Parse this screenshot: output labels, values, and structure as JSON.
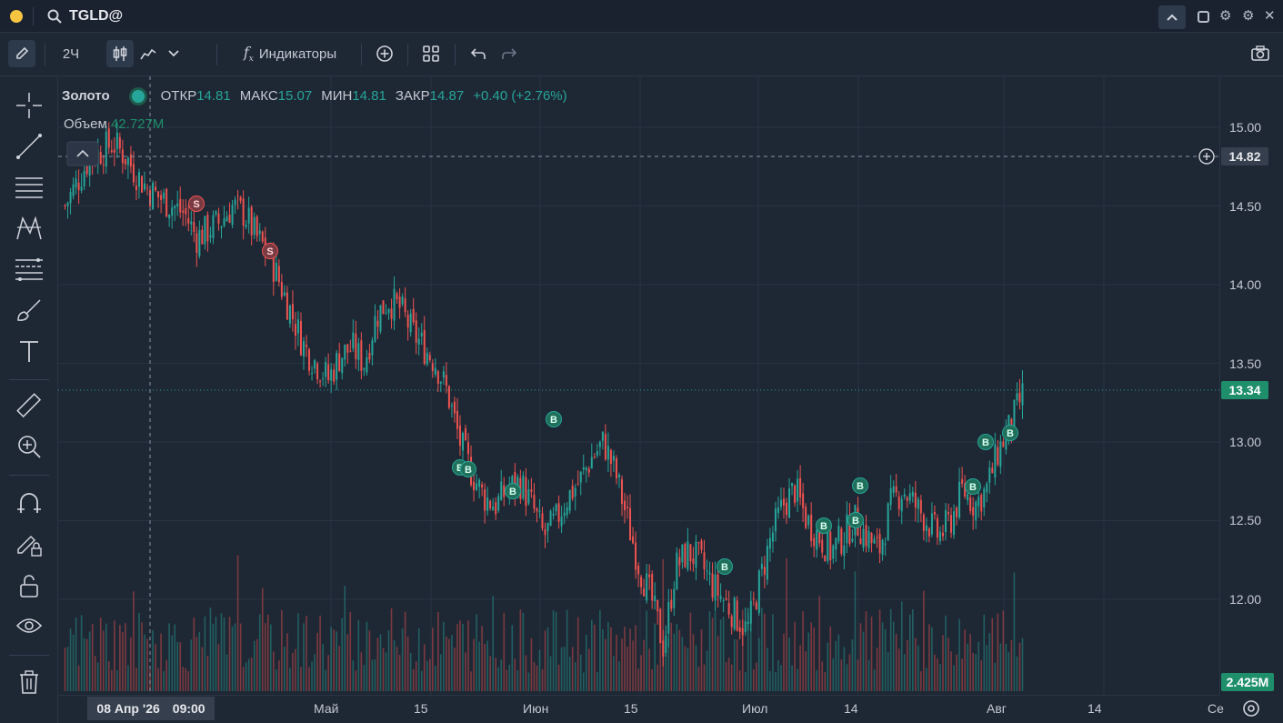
{
  "window": {
    "ticker": "TGLD@"
  },
  "toolbar": {
    "interval": "2Ч",
    "indicators_label": "Индикаторы"
  },
  "legend": {
    "name": "Золото",
    "open_label": "ОТКР",
    "open": "14.81",
    "high_label": "МАКС",
    "high": "15.07",
    "low_label": "МИН",
    "low": "14.81",
    "close_label": "ЗАКР",
    "close": "14.87",
    "change": "+0.40 (+2.76%)",
    "volume_label": "Объем",
    "volume": "42.727M"
  },
  "price_axis": {
    "ticks": [
      "15.00",
      "14.50",
      "14.00",
      "13.50",
      "13.00",
      "12.50",
      "12.00"
    ],
    "crosshair_price": "14.82",
    "last_price": "13.34",
    "volume_tag": "2.425M",
    "colors": {
      "up": "#26a69a",
      "down": "#ef5350",
      "last_price_bg": "#1f8f6b",
      "volume_tag_bg": "#1f8f6b"
    }
  },
  "time_axis": {
    "ticks": [
      "Май",
      "15",
      "Июн",
      "15",
      "Июл",
      "14",
      "Авг",
      "14",
      "Се"
    ],
    "crosshair_date": "08 Апр '26",
    "crosshair_time": "09:00"
  },
  "signals": [
    {
      "label": "S",
      "type": "sell"
    },
    {
      "label": "S",
      "type": "sell"
    },
    {
      "label": "B",
      "type": "buy"
    },
    {
      "label": "B",
      "type": "buy"
    },
    {
      "label": "B",
      "type": "buy"
    },
    {
      "label": "B",
      "type": "buy"
    },
    {
      "label": "B",
      "type": "buy"
    },
    {
      "label": "B",
      "type": "buy"
    },
    {
      "label": "B",
      "type": "buy"
    },
    {
      "label": "B",
      "type": "buy"
    },
    {
      "label": "B",
      "type": "buy"
    },
    {
      "label": "B",
      "type": "buy"
    },
    {
      "label": "B",
      "type": "buy"
    }
  ],
  "chart_data": {
    "type": "candlestick",
    "ylim": [
      11.6,
      15.2
    ],
    "close_path": [
      14.5,
      14.65,
      14.8,
      14.85,
      14.9,
      14.82,
      14.7,
      14.6,
      14.55,
      14.5,
      14.45,
      14.3,
      14.35,
      14.4,
      14.5,
      14.45,
      14.3,
      14.2,
      14.0,
      13.8,
      13.6,
      13.5,
      13.4,
      13.55,
      13.6,
      13.5,
      13.8,
      13.9,
      13.85,
      13.7,
      13.6,
      13.5,
      13.3,
      13.0,
      12.8,
      12.65,
      12.6,
      12.7,
      12.75,
      12.6,
      12.4,
      12.5,
      12.65,
      12.75,
      12.9,
      13.0,
      12.8,
      12.5,
      12.2,
      12.0,
      11.7,
      12.2,
      12.3,
      12.25,
      12.1,
      12.0,
      11.9,
      11.8,
      12.1,
      12.4,
      12.6,
      12.7,
      12.5,
      12.4,
      12.3,
      12.4,
      12.5,
      12.4,
      12.3,
      12.6,
      12.7,
      12.6,
      12.5,
      12.4,
      12.5,
      12.7,
      12.6,
      12.7,
      12.95,
      13.1,
      13.3
    ],
    "volume_unit": "M"
  }
}
